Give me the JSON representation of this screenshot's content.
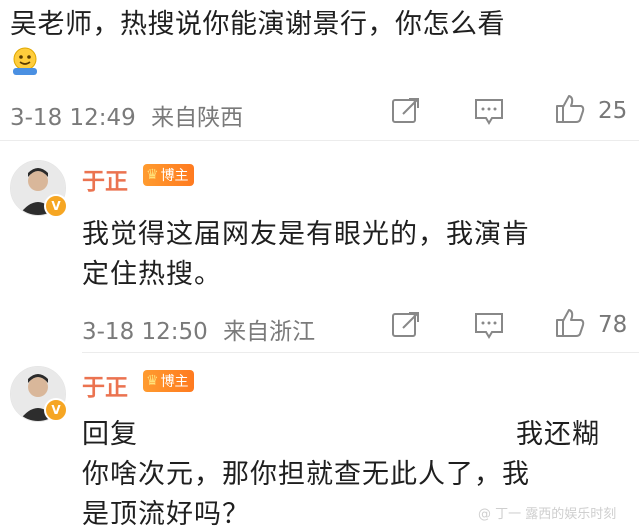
{
  "top_comment": {
    "text": "吴老师，热搜说你能演谢景行，你怎么看",
    "emoji": "smiley-emoji-icon",
    "time": "3-18 12:49",
    "location": "来自陕西",
    "likes": "25"
  },
  "reply1": {
    "author": "于正",
    "badge": "博主",
    "lines": [
      "我觉得这届网友是有眼光的，我演肯",
      "定住热搜。"
    ],
    "time": "3-18 12:50",
    "location": "来自浙江",
    "likes": "78"
  },
  "reply2": {
    "author": "于正",
    "badge": "博主",
    "line1_left": "回复",
    "line1_right": "我还糊",
    "line2": "你啥次元，那你担就查无此人了，我",
    "line3": "是顶流好吗？"
  },
  "watermark": "@ 丁一 露西的娱乐时刻",
  "colors": {
    "author": "#eb7350",
    "badge": "#ff8a2a",
    "meta": "#7a7a7a"
  }
}
